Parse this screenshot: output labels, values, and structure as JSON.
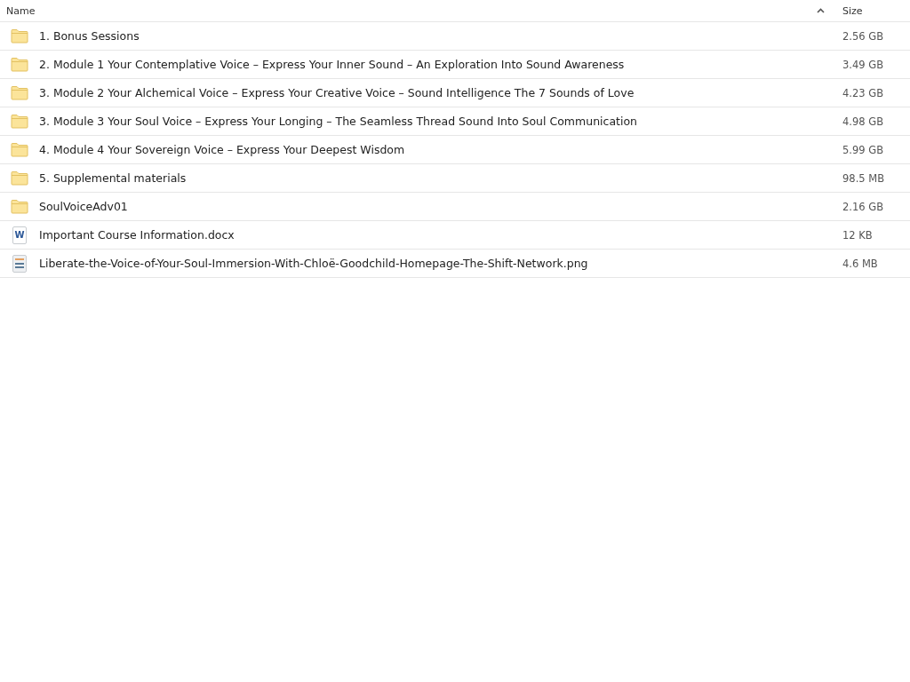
{
  "table": {
    "columns": [
      {
        "label": "Name",
        "sorted": true
      },
      {
        "label": "Size",
        "sorted": false
      }
    ],
    "rows": [
      {
        "kind": "folder",
        "name": "1. Bonus Sessions",
        "size": "2.56 GB"
      },
      {
        "kind": "folder",
        "name": "2. Module 1 Your Contemplative Voice – Express Your Inner Sound – An Exploration Into Sound Awareness",
        "size": "3.49 GB"
      },
      {
        "kind": "folder",
        "name": "3. Module 2 Your Alchemical Voice – Express Your Creative Voice – Sound Intelligence The 7 Sounds of Love",
        "size": "4.23 GB"
      },
      {
        "kind": "folder",
        "name": "3. Module 3 Your Soul Voice – Express Your Longing – The Seamless Thread Sound Into Soul Communication",
        "size": "4.98 GB"
      },
      {
        "kind": "folder",
        "name": "4. Module 4 Your Sovereign Voice – Express Your Deepest Wisdom",
        "size": "5.99 GB"
      },
      {
        "kind": "folder",
        "name": "5. Supplemental materials",
        "size": "98.5 MB"
      },
      {
        "kind": "folder",
        "name": "SoulVoiceAdv01",
        "size": "2.16 GB"
      },
      {
        "kind": "document",
        "icon_label": "W",
        "name": "Important Course Information.docx",
        "size": "12 KB"
      },
      {
        "kind": "image",
        "name": "Liberate-the-Voice-of-Your-Soul-Immersion-With-Chloë-Goodchild-Homepage-The-Shift-Network.png",
        "size": "4.6 MB"
      }
    ]
  }
}
